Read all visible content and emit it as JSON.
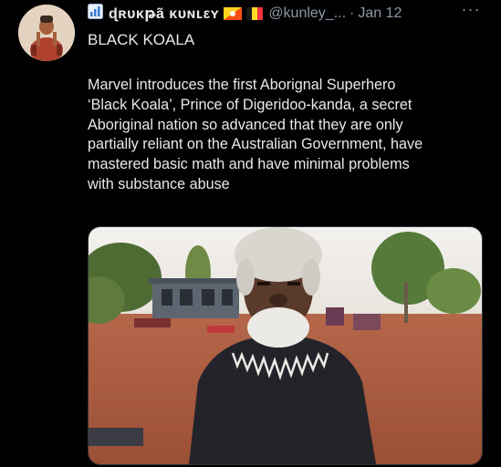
{
  "tweet": {
    "display_name": "ɖʀυκթã κυɴʟεʏ",
    "handle": "@kunley_...",
    "separator": "·",
    "date": "Jan 12",
    "more_label": "···",
    "title": "BLACK KOALA",
    "body_lines": [
      "Marvel introduces the first Aborignal Superhero",
      "‘Black Koala’, Prince of Digeridoo-kanda, a secret",
      "Aboriginal nation so advanced that they are only",
      "partially reliant on the Australian Government, have",
      "mastered basic math and have minimal problems",
      "with substance abuse"
    ]
  },
  "icons": {
    "name_prefix": "chart-emoji-icon",
    "flag_1": "bhutan-flag-icon",
    "flag_2": "belgium-flag-icon",
    "more": "more-options-icon"
  },
  "colors": {
    "background": "#000000",
    "text_primary": "#e7e9ea",
    "text_secondary": "#8b98a5"
  }
}
